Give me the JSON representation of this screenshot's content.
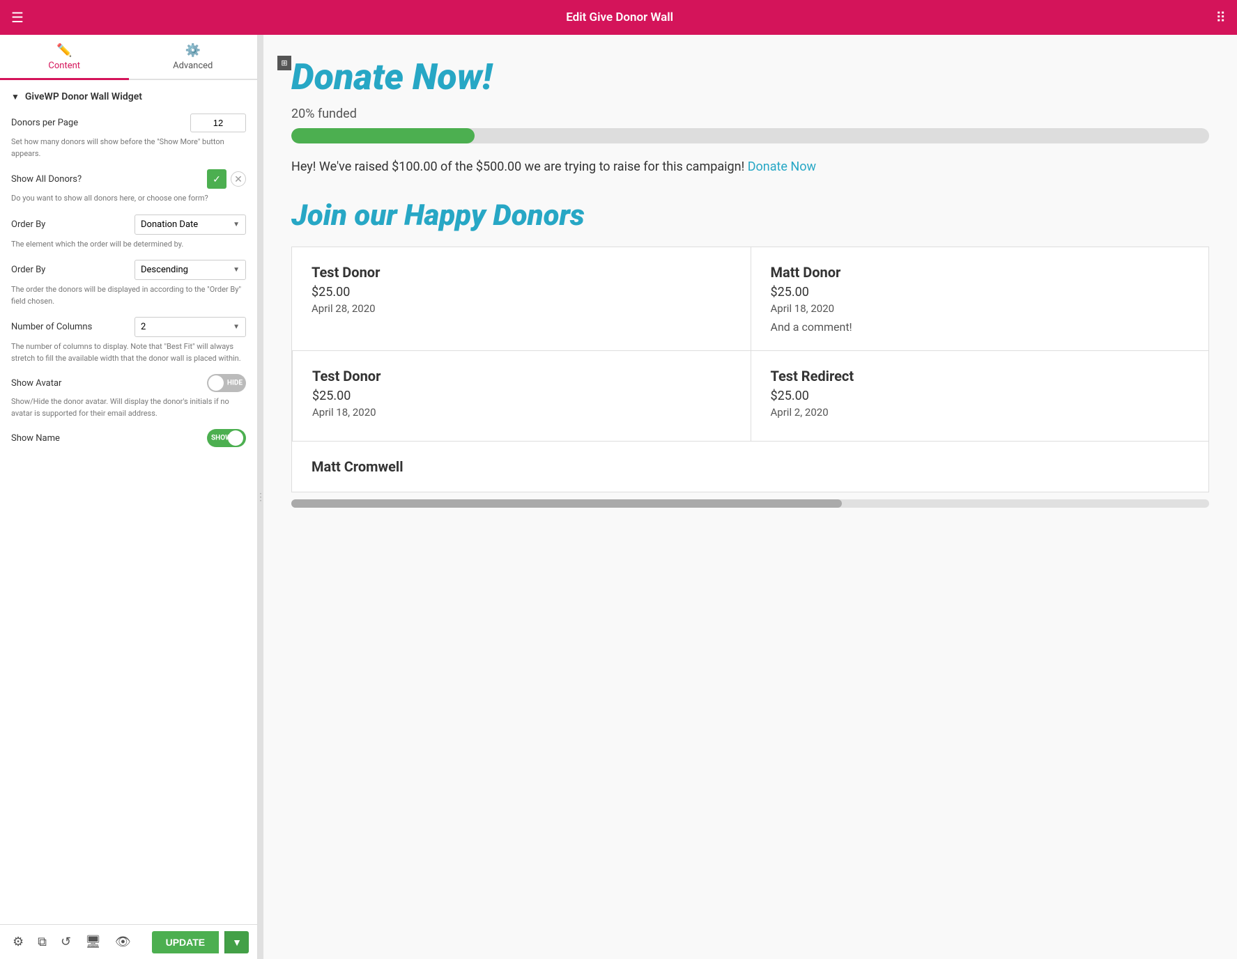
{
  "topbar": {
    "title": "Edit Give Donor Wall",
    "hamburger": "☰",
    "grid": "⠿"
  },
  "tabs": [
    {
      "id": "content",
      "label": "Content",
      "icon": "✏️",
      "active": true
    },
    {
      "id": "advanced",
      "label": "Advanced",
      "icon": "⚙️",
      "active": false
    }
  ],
  "sidebar": {
    "section_title": "GiveWP Donor Wall Widget",
    "donors_per_page_label": "Donors per Page",
    "donors_per_page_value": "12",
    "donors_per_page_hint": "Set how many donors will show before the \"Show More\" button appears.",
    "show_all_donors_label": "Show All Donors?",
    "show_all_donors_hint": "Do you want to show all donors here, or choose one form?",
    "order_by_label_1": "Order By",
    "order_by_value_1": "Donation Date",
    "order_by_hint_1": "The element which the order will be determined by.",
    "order_by_label_2": "Order By",
    "order_by_value_2": "Descending",
    "order_by_hint_2": "The order the donors will be displayed in according to the \"Order By\" field chosen.",
    "num_columns_label": "Number of Columns",
    "num_columns_value": "2",
    "num_columns_hint": "The number of columns to display. Note that \"Best Fit\" will always stretch to fill the available width that the donor wall is placed within.",
    "show_avatar_label": "Show Avatar",
    "show_avatar_toggle": "HIDE",
    "show_avatar_hint": "Show/Hide the donor avatar. Will display the donor's initials if no avatar is supported for their email address.",
    "show_name_label": "Show Name",
    "show_name_toggle": "SHOW"
  },
  "bottom_toolbar": {
    "update_label": "UPDATE"
  },
  "preview": {
    "donate_title": "Donate Now!",
    "funded_text": "20% funded",
    "progress_percent": 20,
    "campaign_text_1": "Hey! We've raised $100.00 of the $500.00 we are trying to raise for this campaign!",
    "donate_link_text": "Donate Now",
    "join_title": "Join our Happy Donors",
    "donors": [
      {
        "name": "Test Donor",
        "amount": "$25.00",
        "date": "April 28, 2020",
        "comment": ""
      },
      {
        "name": "Matt Donor",
        "amount": "$25.00",
        "date": "April 18, 2020",
        "comment": "And a comment!"
      },
      {
        "name": "Test Donor",
        "amount": "$25.00",
        "date": "April 18, 2020",
        "comment": ""
      },
      {
        "name": "Test Redirect",
        "amount": "$25.00",
        "date": "April 2, 2020",
        "comment": ""
      }
    ],
    "partial_donor_name": "Matt Cromwell"
  }
}
